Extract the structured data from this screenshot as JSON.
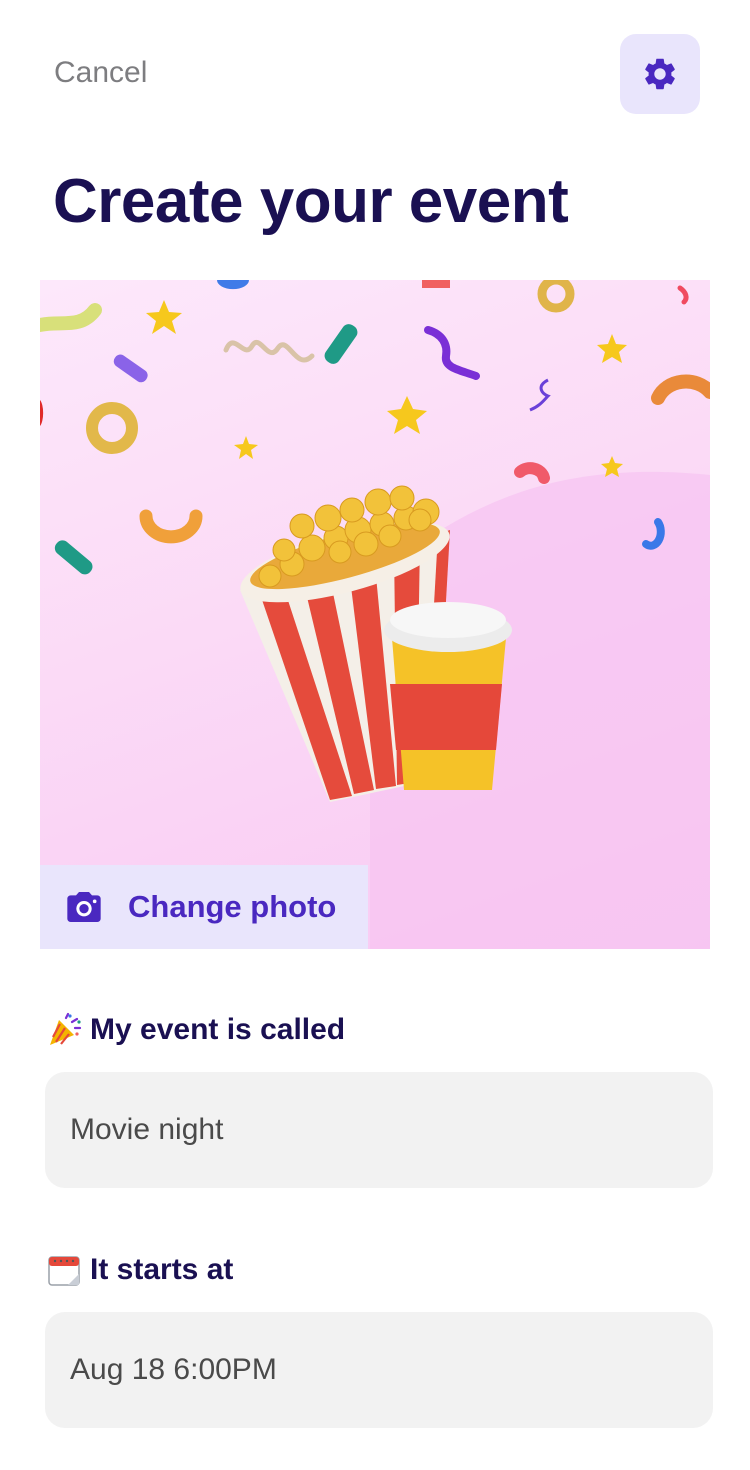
{
  "header": {
    "cancel_label": "Cancel",
    "settings_icon": "gear-icon",
    "accent_color": "#4a28c0",
    "settings_bg": "#e9e5fc"
  },
  "page": {
    "title": "Create your event"
  },
  "hero": {
    "illustration": "popcorn bucket and drink cup with confetti",
    "change_photo_label": "Change photo",
    "change_photo_icon": "camera-icon"
  },
  "form": {
    "name_field": {
      "emoji": "party-popper-icon",
      "label": "My event is called",
      "value": "Movie night"
    },
    "start_field": {
      "emoji": "calendar-icon",
      "label": "It starts at",
      "value": "Aug 18 6:00PM"
    }
  },
  "colors": {
    "title": "#1a1052",
    "field_bg": "#f2f2f2",
    "cancel": "#7d7d80"
  }
}
